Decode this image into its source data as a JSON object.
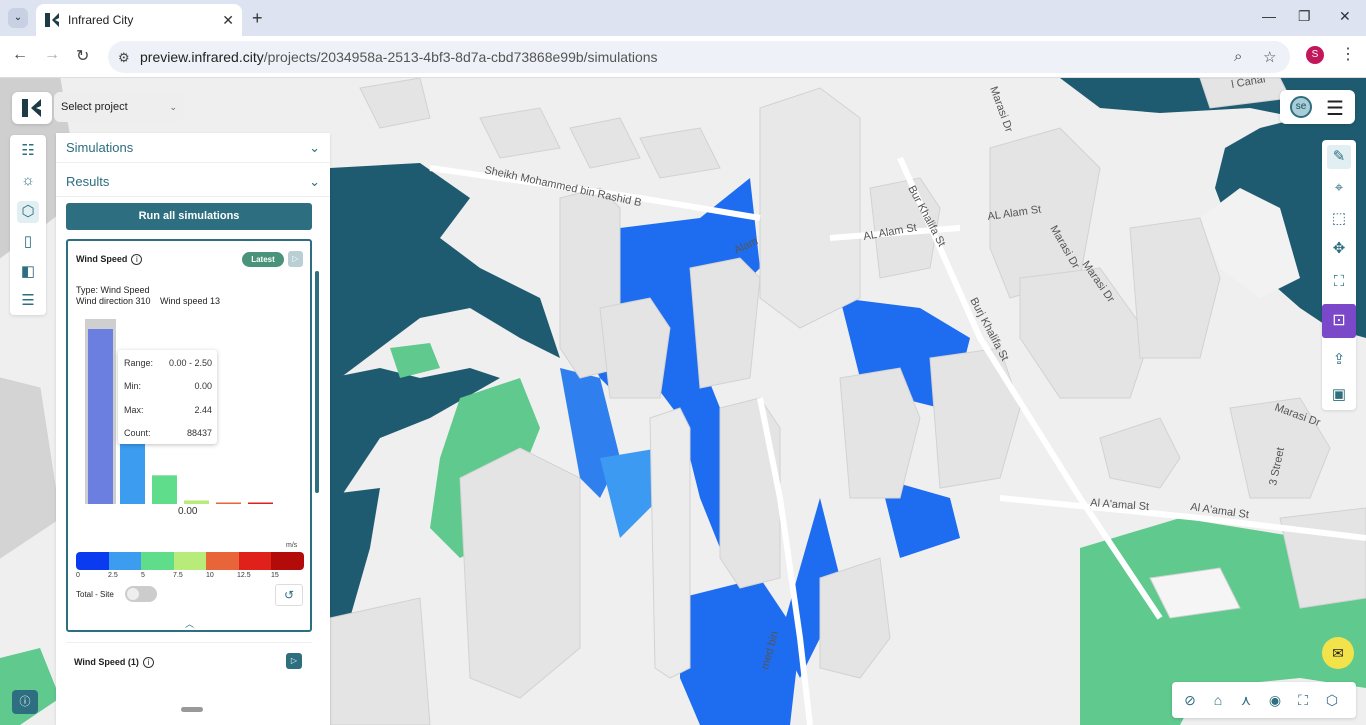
{
  "browser": {
    "tab_title": "Infrared City",
    "tab_close": "✕",
    "new_tab": "+",
    "url_host": "preview.infrared.city",
    "url_path": "/projects/2034958a-2513-4bf3-8d7a-cbd73868e99b/simulations",
    "profile_initial": "S"
  },
  "app": {
    "project_select_label": "Select project",
    "avatar_initials": "se",
    "accordion": {
      "simulations": "Simulations",
      "results": "Results"
    },
    "run_all_label": "Run all simulations",
    "card1": {
      "title": "Wind Speed",
      "badge": "Latest",
      "type_line": "Type: Wind Speed",
      "wind_direction": "Wind direction 310",
      "wind_speed": "Wind speed 13",
      "tooltip": {
        "range_label": "Range:",
        "range_value": "0.00 - 2.50",
        "min_label": "Min:",
        "min_value": "0.00",
        "max_label": "Max:",
        "max_value": "2.44",
        "count_label": "Count:",
        "count_value": "88437"
      },
      "hist_value_label": "0.00",
      "unit": "m/s",
      "legend_ticks": [
        "0",
        "2.5",
        "5",
        "7.5",
        "10",
        "12.5",
        "15"
      ],
      "legend_colors": [
        "#0b3bf0",
        "#3b9cf0",
        "#5fdd8a",
        "#b8ec7a",
        "#e8653a",
        "#e0201a",
        "#b30a0a"
      ],
      "total_site_label": "Total - Site"
    },
    "card2": {
      "title": "Wind Speed (1)"
    }
  },
  "map": {
    "streets": [
      "Sheikh Mohammed bin Rashid B",
      "AL Alam St",
      "Bur Khalifa St",
      "Burj Khalifa St",
      "AL Alam St",
      "Marasi Dr",
      "Marasi Dr",
      "Marasi Dr",
      "Al A'amal St",
      "Al A'amal St",
      "3 Street",
      "med bin",
      "Alam",
      "Marasi Dr",
      "l Canal"
    ]
  },
  "chart_data": {
    "type": "bar",
    "title": "",
    "categories": [
      "0-2.5",
      "2.5-5",
      "5-7.5",
      "7.5-10",
      "10-12.5",
      "12.5-15"
    ],
    "values": [
      88437,
      47000,
      14500,
      1800,
      700,
      100
    ],
    "colors": [
      "#6b7fe0",
      "#3b9cf0",
      "#5fdd8a",
      "#b8ec7a",
      "#e8653a",
      "#e0201a"
    ],
    "xlabel": "",
    "ylabel": ""
  }
}
